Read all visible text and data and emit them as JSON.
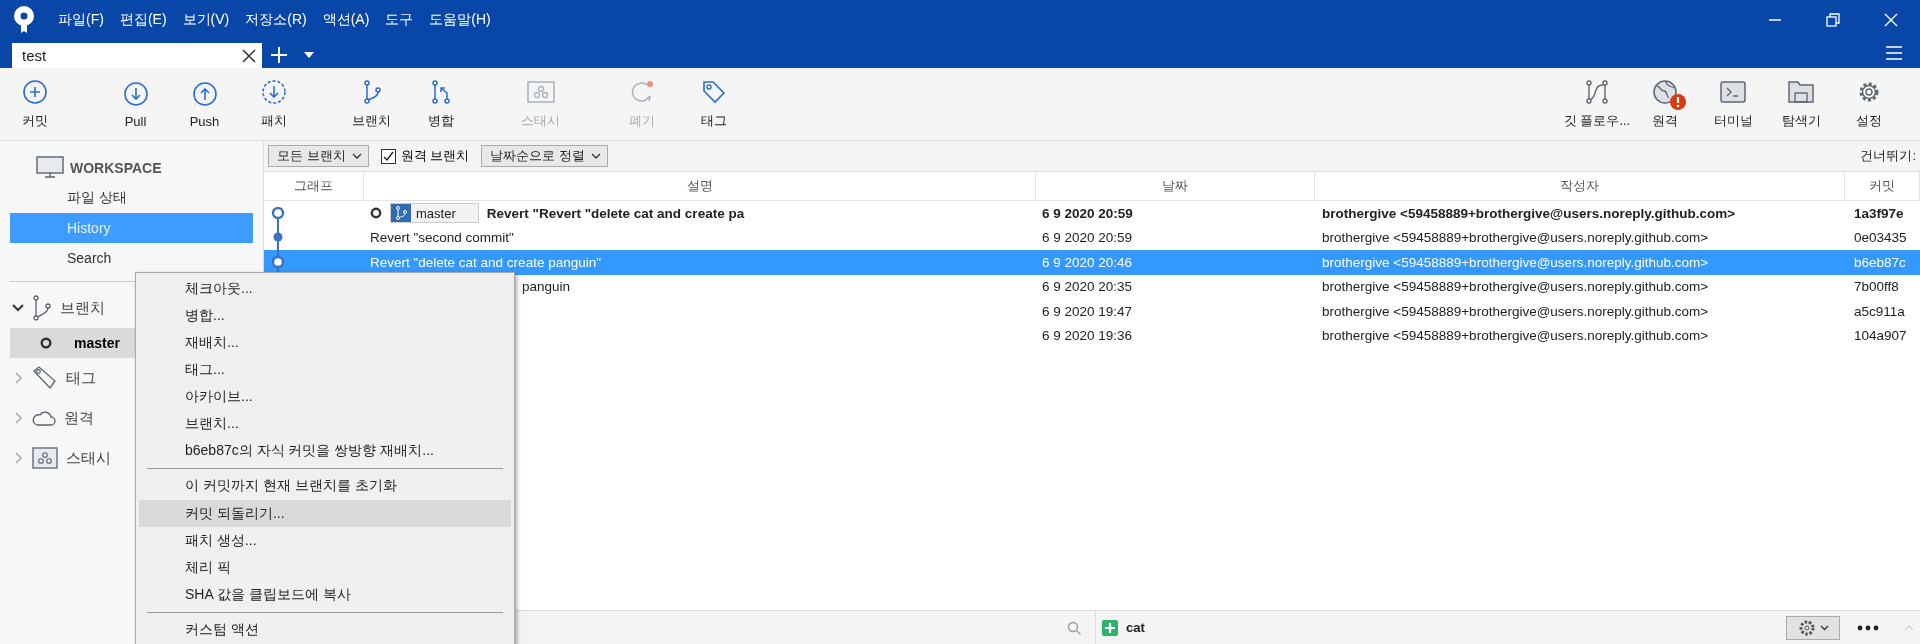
{
  "menu_bar": [
    "파일(F)",
    "편집(E)",
    "보기(V)",
    "저장소(R)",
    "액션(A)",
    "도구",
    "도움말(H)"
  ],
  "tabs": [
    {
      "label": "test",
      "selected": true
    }
  ],
  "toolbar": {
    "left": [
      {
        "label": "커밋",
        "kind": "commit",
        "disabled": false
      },
      {
        "label": "Pull",
        "kind": "pull",
        "disabled": false
      },
      {
        "label": "Push",
        "kind": "push",
        "disabled": false
      },
      {
        "label": "패치",
        "kind": "fetch",
        "disabled": false
      },
      {
        "label": "브랜치",
        "kind": "branch",
        "disabled": false
      },
      {
        "label": "병합",
        "kind": "merge",
        "disabled": false
      },
      {
        "label": "스태시",
        "kind": "stash",
        "disabled": true
      },
      {
        "label": "폐기",
        "kind": "discard",
        "disabled": true
      },
      {
        "label": "태그",
        "kind": "tag",
        "disabled": false
      }
    ],
    "right": [
      {
        "label": "깃 플로우...",
        "kind": "flow",
        "alert": false
      },
      {
        "label": "원격",
        "kind": "globe",
        "alert": true
      },
      {
        "label": "터미널",
        "kind": "terminal",
        "alert": false
      },
      {
        "label": "탐색기",
        "kind": "folder",
        "alert": false
      },
      {
        "label": "설정",
        "kind": "gear",
        "alert": false
      }
    ]
  },
  "sidebar": {
    "workspace": {
      "label": "WORKSPACE",
      "items": [
        {
          "label": "파일 상태",
          "selected": false
        },
        {
          "label": "History",
          "selected": true
        },
        {
          "label": "Search",
          "selected": false
        }
      ]
    },
    "sections": [
      {
        "label": "브랜치",
        "kind": "branch",
        "expanded": true,
        "children": [
          {
            "label": "master",
            "selected": true
          }
        ]
      },
      {
        "label": "태그",
        "kind": "tag",
        "expanded": false
      },
      {
        "label": "원격",
        "kind": "cloud",
        "expanded": false
      },
      {
        "label": "스태시",
        "kind": "stash",
        "expanded": false
      }
    ]
  },
  "filter_bar": {
    "branch_filter": "모든 브랜치",
    "remote_branches": {
      "label": "원격 브랜치",
      "checked": true
    },
    "sort": "날짜순으로 정렬",
    "jump_label": "건너뛰기:"
  },
  "table": {
    "columns": [
      "그래프",
      "설명",
      "날짜",
      "작성자",
      "커밋"
    ],
    "rows": [
      {
        "kind": "hollow",
        "branch_label": "master",
        "description": "Revert \"Revert \"delete cat and create pa",
        "date": "6 9 2020 20:59",
        "author": "brothergive <59458889+brothergive@users.noreply.github.com>",
        "commit": "1a3f97e",
        "head": true,
        "selected": false,
        "covered": false
      },
      {
        "kind": "filled",
        "description": "Revert \"second commit\"",
        "date": "6 9 2020 20:59",
        "author": "brothergive <59458889+brothergive@users.noreply.github.com>",
        "commit": "0e03435",
        "head": false,
        "selected": false,
        "covered": false
      },
      {
        "kind": "hollow",
        "description": "Revert \"delete cat and create panguin\"",
        "date": "6 9 2020 20:46",
        "author": "brothergive <59458889+brothergive@users.noreply.github.com>",
        "commit": "b6eb87c",
        "head": false,
        "selected": true,
        "covered": false
      },
      {
        "description": "panguin",
        "date": "6 9 2020 20:35",
        "author": "brothergive <59458889+brothergive@users.noreply.github.com>",
        "commit": "7b00ff8",
        "head": false,
        "selected": false,
        "covered": true
      },
      {
        "date": "6 9 2020 19:47",
        "author": "brothergive <59458889+brothergive@users.noreply.github.com>",
        "commit": "a5c911a",
        "head": false,
        "selected": false
      },
      {
        "date": "6 9 2020 19:36",
        "author": "brothergive <59458889+brothergive@users.noreply.github.com>",
        "commit": "104a907",
        "head": false,
        "selected": false
      }
    ]
  },
  "files": [
    {
      "name": "cat",
      "kind": "added"
    }
  ],
  "context_menu": [
    {
      "label": "체크아웃...",
      "separator_before": false,
      "selected": false
    },
    {
      "label": "병합...",
      "separator_before": false,
      "selected": false
    },
    {
      "label": "재배치...",
      "separator_before": false,
      "selected": false
    },
    {
      "label": "태그...",
      "separator_before": false,
      "selected": false
    },
    {
      "label": "아카이브...",
      "separator_before": false,
      "selected": false
    },
    {
      "label": "브랜치...",
      "separator_before": false,
      "selected": false
    },
    {
      "label": "b6eb87c의 자식 커밋을 쌍방향 재배치...",
      "separator_before": false,
      "selected": false
    },
    {
      "label": "이 커밋까지 현재 브랜치를 초기화",
      "separator_before": true,
      "selected": false
    },
    {
      "label": "커밋 되돌리기...",
      "separator_before": false,
      "selected": true
    },
    {
      "label": "패치 생성...",
      "separator_before": false,
      "selected": false
    },
    {
      "label": "체리 픽",
      "separator_before": false,
      "selected": false
    },
    {
      "label": "SHA 값을 클립보드에 복사",
      "separator_before": false,
      "selected": false
    },
    {
      "label": "커스텀 액션",
      "separator_before": true,
      "selected": false
    }
  ]
}
